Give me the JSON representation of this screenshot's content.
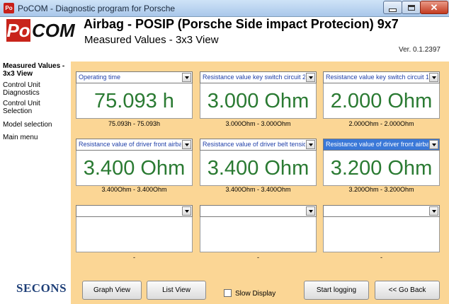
{
  "window": {
    "icon_text": "Po",
    "title": "PoCOM - Diagnostic program for Porsche",
    "controls": [
      "minimize",
      "maximize",
      "close"
    ]
  },
  "header": {
    "logo_po": "Po",
    "logo_com": "COM",
    "title": "Airbag - POSIP (Porsche Side impact Protecion) 9x7",
    "subtitle": "Measured Values - 3x3 View",
    "version": "Ver. 0.1.2397"
  },
  "sidebar": {
    "items": [
      {
        "label": "Measured Values - 3x3 View",
        "active": true
      },
      {
        "label": "Control Unit Diagnostics",
        "active": false
      },
      {
        "label": "Control Unit Selection",
        "active": false
      },
      {
        "label": "Model selection",
        "active": false
      },
      {
        "label": "Main menu",
        "active": false
      }
    ],
    "brand": "SECONS"
  },
  "grid": {
    "cells": [
      {
        "parameter": "Operating time",
        "value": "75.093 h",
        "range": "75.093h - 75.093h",
        "selected": false
      },
      {
        "parameter": "Resistance value key switch circuit 2",
        "value": "3.000 Ohm",
        "range": "3.000Ohm - 3.000Ohm",
        "selected": false
      },
      {
        "parameter": "Resistance value key switch circuit 1",
        "value": "2.000 Ohm",
        "range": "2.000Ohm - 2.000Ohm",
        "selected": false
      },
      {
        "parameter": "Resistance value of driver front airbag st",
        "value": "3.400 Ohm",
        "range": "3.400Ohm - 3.400Ohm",
        "selected": false
      },
      {
        "parameter": "Resistance value of driver belt tensioner",
        "value": "3.400 Ohm",
        "range": "3.400Ohm - 3.400Ohm",
        "selected": false
      },
      {
        "parameter": "Resistance value of driver front airbag s",
        "value": "3.200 Ohm",
        "range": "3.200Ohm - 3.200Ohm",
        "selected": true
      },
      {
        "parameter": "",
        "value": "",
        "range": "-",
        "selected": false
      },
      {
        "parameter": "",
        "value": "",
        "range": "-",
        "selected": false
      },
      {
        "parameter": "",
        "value": "",
        "range": "-",
        "selected": false
      }
    ],
    "value_color": "#2a7a32",
    "highlight_color": "#3a78d8"
  },
  "toolbar": {
    "graph_view": "Graph View",
    "list_view": "List View",
    "slow_display": "Slow Display",
    "slow_display_checked": false,
    "start_logging": "Start logging",
    "go_back": "<< Go Back"
  },
  "colors": {
    "panel_bg": "#fbd695",
    "brand_red": "#c8241b",
    "brand_blue": "#1e3f78"
  }
}
